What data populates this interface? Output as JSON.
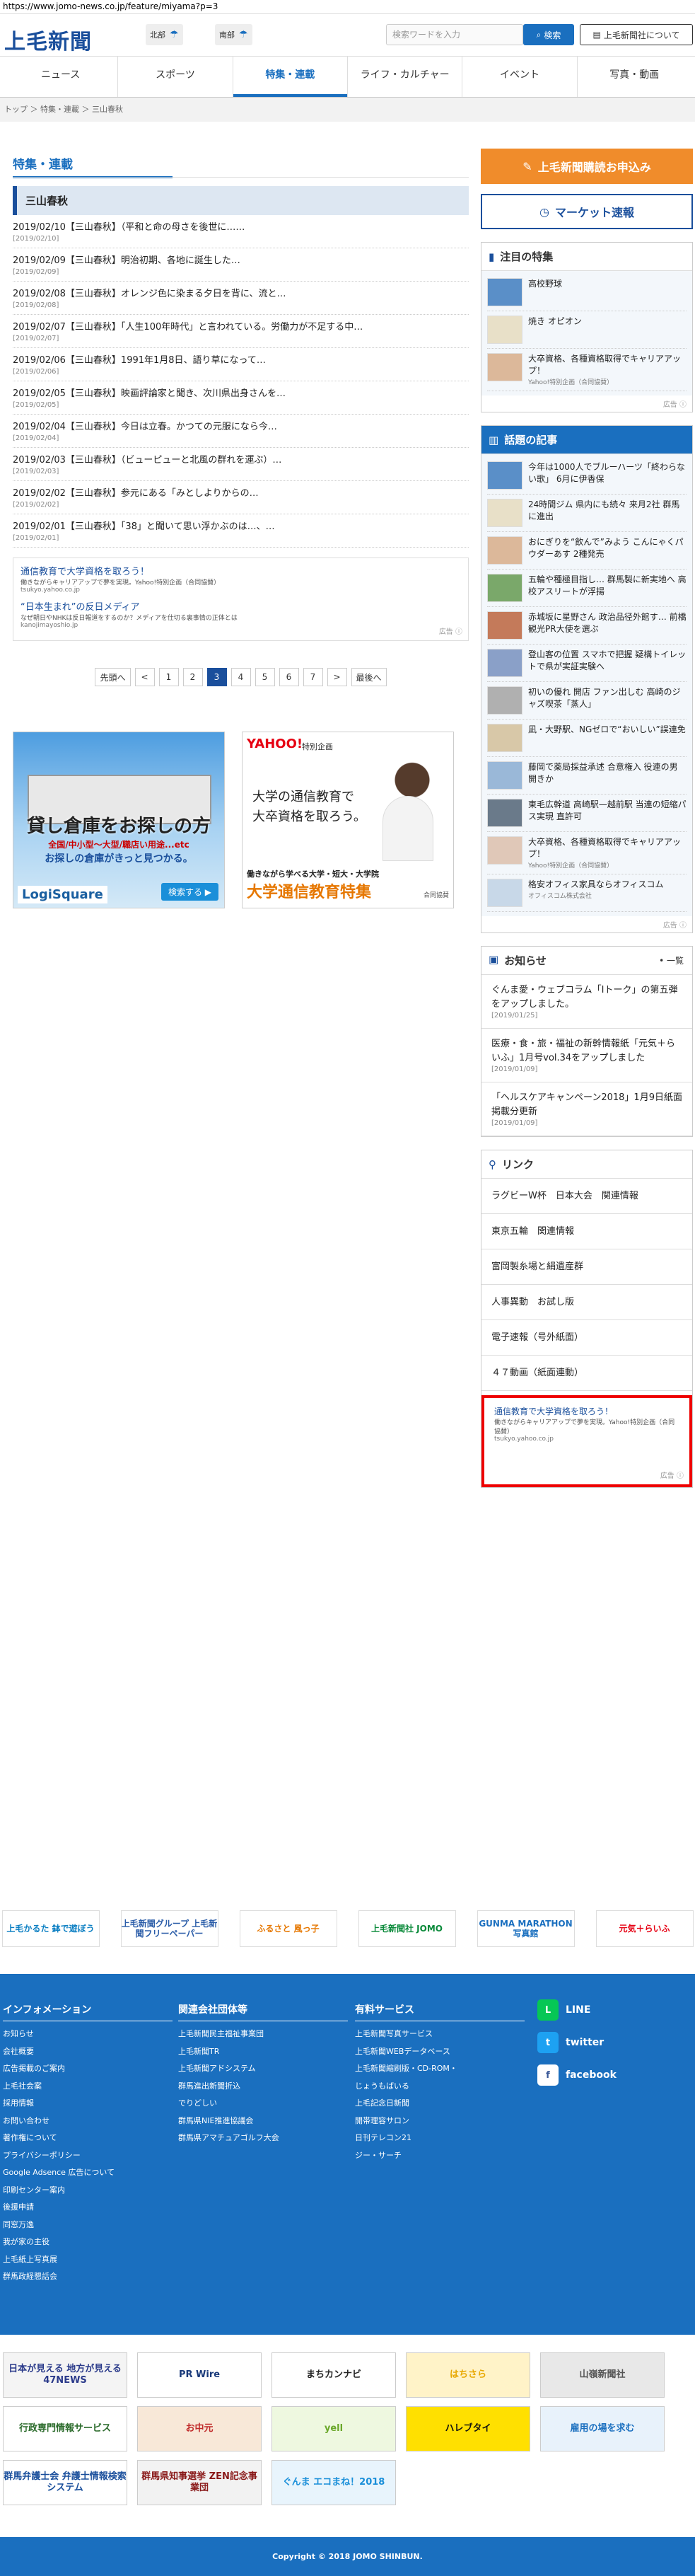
{
  "browser": {
    "url": "https://www.jomo-news.co.jp/feature/miyama?p=3"
  },
  "header": {
    "logo": "上毛新聞",
    "weather": [
      {
        "area": "北部"
      },
      {
        "area": "南部"
      }
    ],
    "search_placeholder": "検索ワードを入力",
    "search_label": "検索",
    "about_label": "上毛新聞社について"
  },
  "nav": [
    "ニュース",
    "スポーツ",
    "特集・連載",
    "ライフ・カルチャー",
    "イベント",
    "写真・動画"
  ],
  "breadcrumb": "トップ ＞ 特集・連載 ＞ 三山春秋",
  "main": {
    "section_title": "特集・連載",
    "subsection": "三山春秋",
    "articles": [
      {
        "title": "2019/02/10【三山春秋】（平和と命の母さを後世に……",
        "date": "[2019/02/10]"
      },
      {
        "title": "2019/02/09【三山春秋】明治初期、各地に誕生した…",
        "date": "[2019/02/09]"
      },
      {
        "title": "2019/02/08【三山春秋】オレンジ色に染まる夕日を背に、流と…",
        "date": "[2019/02/08]"
      },
      {
        "title": "2019/02/07【三山春秋】「人生100年時代」と言われている。労働力が不足する中…",
        "date": "[2019/02/07]"
      },
      {
        "title": "2019/02/06【三山春秋】1991年1月8日、語り草になって…",
        "date": "[2019/02/06]"
      },
      {
        "title": "2019/02/05【三山春秋】映画評論家と聞き、次川県出身さんを…",
        "date": "[2019/02/05]"
      },
      {
        "title": "2019/02/04【三山春秋】今日は立春。かつての元服になら今…",
        "date": "[2019/02/04]"
      },
      {
        "title": "2019/02/03【三山春秋】（ビューピューと北風の群れを運ぶ）…",
        "date": "[2019/02/03]"
      },
      {
        "title": "2019/02/02【三山春秋】参元にある「みとしよりからの…",
        "date": "[2019/02/02]"
      },
      {
        "title": "2019/02/01【三山春秋】「38」と聞いて思い浮かぶのは…、…",
        "date": "[2019/02/01]"
      }
    ],
    "ads": [
      {
        "title": "通信教育で大学資格を取ろう！",
        "sub": "働きながらキャリアアップで夢を実現。Yahoo!特別企画（合同協賛）",
        "url": "tsukyo.yahoo.co.jp"
      },
      {
        "title": "“日本生まれ”の反日メディア",
        "sub": "なぜ朝日やNHKは反日報道をするのか？メディアを仕切る裏事情の正体とは",
        "url": "kanojimayoshio.jp"
      }
    ],
    "ad_label": "広告",
    "pager": [
      "先頭へ",
      "<",
      "1",
      "2",
      "3",
      "4",
      "5",
      "6",
      "7",
      ">",
      "最後へ"
    ],
    "pager_current": "3"
  },
  "banners": {
    "b1": {
      "title": "貸し倉庫をお探しの方",
      "sub": "全国/中小型～大型/職店い用途...etc",
      "sub2": "お探しの倉庫がきっと見つかる。",
      "logo": "LogiSquare",
      "btn": "検索する ▶"
    },
    "b2": {
      "yahoo": "YAHOO!",
      "tag": "特別企画",
      "text1": "大学の通信教育で",
      "text2": "大卒資格を取ろう。",
      "b1": "働きながら学べる大学・短大・大学院",
      "b2": "大学通信教育特集",
      "b3": "合同協賛"
    }
  },
  "side": {
    "subscribe": "上毛新聞購読お申込み",
    "market": "マーケット速報",
    "featured_title": "注目の特集",
    "featured": [
      {
        "t": "高校野球",
        "s": ""
      },
      {
        "t": "焼き オピオン",
        "s": ""
      },
      {
        "t": "大卒資格、各種資格取得でキャリアアップ！",
        "s": "Yahoo!特別企画（合同協賛）"
      }
    ],
    "hot_title": "話題の記事",
    "hot": [
      {
        "t": "今年は1000人でブルーハーツ「終わらない歌」 6月に伊香保",
        "s": ""
      },
      {
        "t": "24時間ジム 県内にも続々 来月2社 群馬に進出",
        "s": ""
      },
      {
        "t": "おにぎりを“飲んで”みよう こんにゃくパウダーあす 2種発売",
        "s": ""
      },
      {
        "t": "五輪や種極目指し… 群馬製に新実地へ 高校アスリートが浮揚",
        "s": ""
      },
      {
        "t": "赤城坂に星野さん 政治品径外館す… 前橋 観光PR大使を選ぶ",
        "s": ""
      },
      {
        "t": "登山客の位置 スマホで把握 疑構トイレットで県が実証実験へ",
        "s": ""
      },
      {
        "t": "初いの優れ 開店 ファン出しむ 高崎のジャズ喫茶「蒸人」",
        "s": ""
      },
      {
        "t": "凪・大野駅、NGゼロで“おいしい”誤連免",
        "s": ""
      },
      {
        "t": "藤岡で薬局採益承述 合意権入 役連の男 開きか",
        "s": ""
      },
      {
        "t": "東毛広幹道 高崎駅—越前駅 当連の短縮パス実現 直許可",
        "s": ""
      },
      {
        "t": "大卒資格、各種資格取得でキャリアアップ！",
        "s": "Yahoo!特別企画（合同協賛）"
      },
      {
        "t": "格安オフィス家具ならオフィスコム",
        "s": "オフィスコム株式会社"
      }
    ],
    "ad_label": "広告",
    "notice_title": "お知らせ",
    "notice_more": "一覧",
    "notices": [
      {
        "t": "ぐんま愛・ウェブコラム「Iトーク」の第五弾をアップしました。",
        "d": "[2019/01/25]"
      },
      {
        "t": "医療・食・旅・福祉の新幹情報紙「元気＋らいふ」1月号vol.34をアップしました",
        "d": "[2019/01/09]"
      },
      {
        "t": "「ヘルスケアキャンペーン2018」1月9日紙面掲載分更新",
        "d": "[2019/01/09]"
      }
    ],
    "links_title": "リンク",
    "links": [
      "ラグビーW杯　日本大会　関連情報",
      "東京五輪　関連情報",
      "富岡製糸場と絹遺産群",
      "人事異動　お試し版",
      "電子速報（号外紙面）",
      "４７動画（紙面連動）"
    ],
    "link_ad": {
      "title": "通信教育で大学資格を取ろう！",
      "sub": "働きながらキャリアアップで夢を実現。Yahoo!特別企画（合同協賛）",
      "url": "tsukyo.yahoo.co.jp"
    }
  },
  "bottom_links": [
    "上毛かるた 鉢で遊ぼう",
    "上毛新聞グループ 上毛新聞フリーペーパー",
    "ふるさと 風っ子",
    "上毛新聞社 JOMO",
    "GUNMA MARATHON 写真館",
    "元気＋らいふ"
  ],
  "footer": {
    "info_title": "インフォメーション",
    "info": [
      "お知らせ",
      "会社概要",
      "広告掲載のご案内",
      "上毛社会案",
      "採用情報",
      "お問い合わせ",
      "著作権について",
      "プライバシーポリシー",
      "Google Adsence 広告について",
      "印刷センター案内",
      "後援申請",
      "同窓万逸",
      "我が家の主役",
      "上毛紙上写真展",
      "群馬政経懇話会"
    ],
    "rel_title": "関連会社団体等",
    "rel": [
      "上毛新聞民主福祉事業団",
      "上毛新聞TR",
      "上毛新聞アドシステム",
      "群馬進出新聞折込",
      "でりどしい",
      "群馬県NIE推進協議会",
      "群馬県アマチュアゴルフ大会"
    ],
    "paid_title": "有料サービス",
    "paid": [
      "上毛新聞写真サービス",
      "上毛新聞WEBデータベース",
      "上毛新聞縮刷版・CD-ROM・",
      "じょうもばいる",
      "上毛記念日新聞",
      "開帯理容サロン",
      "日刊テレコン21",
      "ジー・サーチ"
    ],
    "sns": [
      "LINE",
      "twitter",
      "facebook"
    ]
  },
  "logos": [
    [
      "日本が見える 地方が見える 47NEWS",
      "PR Wire",
      "まちカンナビ",
      "はちさら",
      "山嶺新聞社"
    ],
    [
      "行政専門情報サービス",
      "お中元",
      "yell",
      "ハレブタイ",
      "雇用の場を求む"
    ],
    [
      "群馬弁護士会 弁護士情報検索システム",
      "群馬県知事選挙 ZEN記念事業団",
      "ぐんま エコまね！2018"
    ]
  ],
  "copyright": "Copyright © 2018 JOMO SHINBUN.",
  "colors": {
    "brand": "#1a6fbf",
    "navy": "#1a4f9c",
    "orange": "#f08c2b",
    "alert": "#e00000"
  }
}
